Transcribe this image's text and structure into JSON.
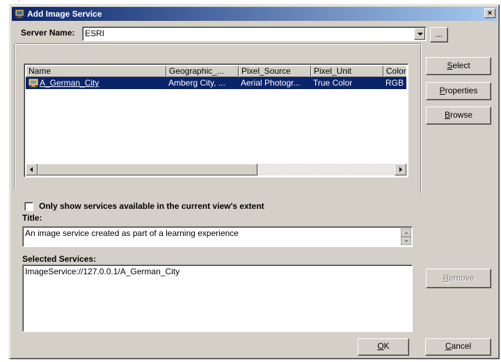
{
  "window": {
    "title": "Add Image Service",
    "close_symbol": "×"
  },
  "server": {
    "label": "Server Name:",
    "value": "ESRI",
    "browse_label": "..."
  },
  "services_list": {
    "columns": [
      "Name",
      "Geographic_...",
      "Pixel_Source",
      "Pixel_Unit",
      "Color"
    ],
    "rows": [
      {
        "name": "A_German_City",
        "geographic": "Amberg City, ...",
        "pixel_source": "Aerial Photogr...",
        "pixel_unit": "True Color",
        "color": "RGB",
        "selected": true
      }
    ]
  },
  "buttons": {
    "select": "Select",
    "properties": "Properties",
    "browse": "Browse",
    "remove": "Remove",
    "ok": "OK",
    "cancel": "Cancel"
  },
  "extent_checkbox": {
    "label": "Only show services available in the current view's extent",
    "checked": false
  },
  "title_field": {
    "label": "Title:",
    "value": "An image service created as part of a learning experience"
  },
  "selected_services": {
    "label": "Selected Services:",
    "items": [
      "ImageService://127.0.0.1/A_German_City"
    ]
  },
  "colors": {
    "titlebar_start": "#0a246a",
    "titlebar_end": "#a6caf0",
    "selection": "#0a246a",
    "face": "#d4d0c8"
  }
}
